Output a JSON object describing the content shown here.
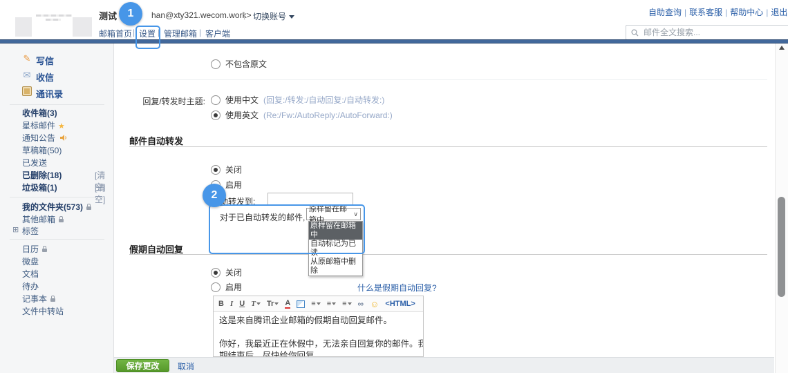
{
  "ui": {
    "sep": "|"
  },
  "icons": {
    "pencil": "✎",
    "envelope": "✉",
    "star": "★",
    "expand_box": "⊞",
    "chevron_down": "∨",
    "menu_bars": "≡",
    "chain_link": "∞",
    "smiley": "☺"
  },
  "colors": {
    "accent_blue": "#4796e8",
    "brand_bar": "#42689b",
    "link_blue": "#2b5fa8",
    "save_green": "#55982a",
    "star_yellow": "#f5b63f"
  },
  "annotations": {
    "step1": "1",
    "step2": "2"
  },
  "header": {
    "account_name": "测试",
    "account_email": "han@xty321.wecom.work>",
    "switch_account": "切换账号",
    "nav": [
      {
        "label": "邮箱首页"
      },
      {
        "label": "设置"
      },
      {
        "label": "管理邮箱"
      },
      {
        "label": "客户端"
      }
    ],
    "top_links": [
      {
        "label": "自助查询"
      },
      {
        "label": "联系客服"
      },
      {
        "label": "帮助中心"
      },
      {
        "label": "退出"
      }
    ],
    "search_placeholder": "邮件全文搜索..."
  },
  "sidebar": {
    "actions": [
      {
        "label": "写信"
      },
      {
        "label": "收信"
      },
      {
        "label": "通讯录"
      }
    ],
    "folders": [
      {
        "label": "收件箱(3)"
      },
      {
        "label": "星标邮件"
      },
      {
        "label": "通知公告"
      },
      {
        "label": "草稿箱(50)"
      },
      {
        "label": "已发送"
      },
      {
        "label": "已删除(18)",
        "action": "[清空]"
      },
      {
        "label": "垃圾箱(1)",
        "action": "[清空]"
      }
    ],
    "groups": [
      {
        "label": "我的文件夹(573)"
      },
      {
        "label": "其他邮箱"
      },
      {
        "label": "标签"
      }
    ],
    "tools": [
      {
        "label": "日历"
      },
      {
        "label": "微盘"
      },
      {
        "label": "文档"
      },
      {
        "label": "待办"
      },
      {
        "label": "记事本"
      },
      {
        "label": "文件中转站"
      }
    ]
  },
  "settings": {
    "include_original": {
      "option_off": "不包含原文"
    },
    "reply_subject": {
      "label": "回复/转发时主题:",
      "chinese": "使用中文",
      "chinese_note": "(回复:/转发:/自动回复:/自动转发:)",
      "english": "使用英文",
      "english_note": "(Re:/Fw:/AutoReply:/AutoForward:)"
    },
    "auto_forward": {
      "title": "邮件自动转发",
      "option_off": "关闭",
      "option_on": "启用",
      "forward_to_label": "自动转发到:",
      "forward_to_value": "",
      "forwarded_mail_label": "对于已自动转发的邮件,",
      "select_value": "原样留在邮箱中",
      "options": [
        {
          "label": "原样留在邮箱中"
        },
        {
          "label": "自动标记为已读"
        },
        {
          "label": "从原邮箱中删除"
        }
      ]
    },
    "vacation_reply": {
      "title": "假期自动回复",
      "option_off": "关闭",
      "option_on": "启用",
      "help_link": "什么是假期自动回复?",
      "toolbar": {
        "bold": "B",
        "italic": "I",
        "underline": "U",
        "font": "T",
        "font_size": "Tr",
        "font_color": "A",
        "html": "<HTML>"
      },
      "editor": {
        "line1": "这是来自腾讯企业邮箱的假期自动回复邮件。",
        "line2": "",
        "line3": "你好，我最近正在休假中，无法亲自回复你的邮件。我将在假",
        "line4": "期结束后，尽快给你回复"
      }
    }
  },
  "footer": {
    "save": "保存更改",
    "cancel": "取消"
  }
}
